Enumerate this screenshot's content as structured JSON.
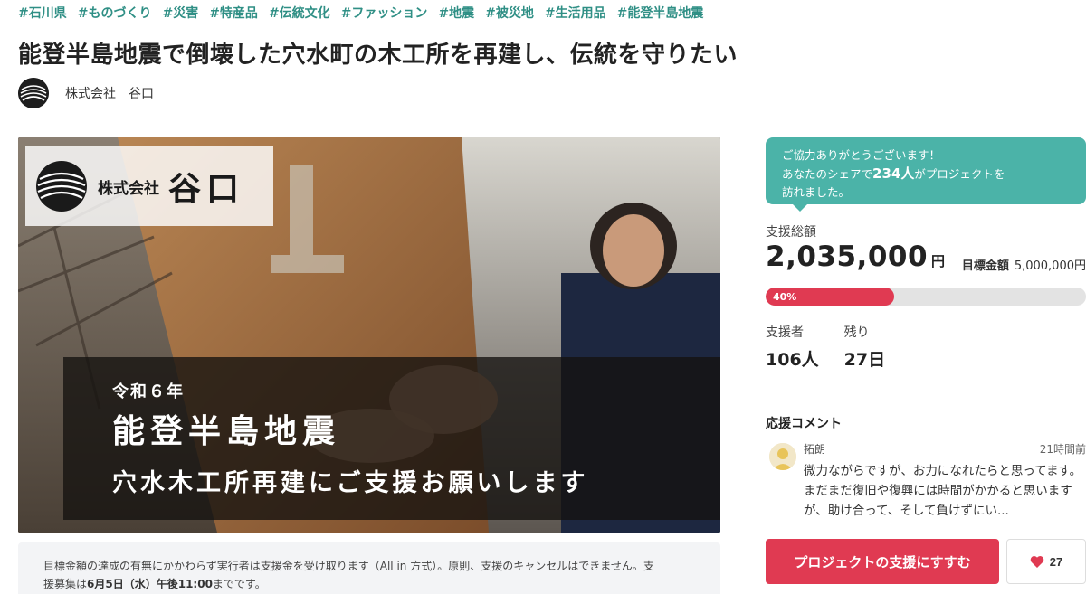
{
  "tags": [
    "#石川県",
    "#ものづくり",
    "#災害",
    "#特産品",
    "#伝統文化",
    "#ファッション",
    "#地震",
    "#被災地",
    "#生活用品",
    "#能登半島地震"
  ],
  "title": "能登半島地震で倒壊した穴水町の木工所を再建し、伝統を守りたい",
  "owner": {
    "name": "株式会社　谷口"
  },
  "hero": {
    "logo_label": "株式会社",
    "logo_name": "谷口",
    "headline_small": "令和６年",
    "headline_big": "能登半島地震",
    "headline_sub": "穴水木工所再建にご支援お願いします"
  },
  "notice": {
    "text_1": "目標金額の達成の有無にかかわらず実行者は支援金を受け取ります（All in 方式）。原則、支援のキャンセルはできません。支",
    "text_2_prefix": "援募集は",
    "text_2_bold": "6月5日（水）午後11:00",
    "text_2_suffix": "までです。"
  },
  "share": {
    "line1": "ご協力ありがとうございます！",
    "line2_prefix": "あなたのシェアで",
    "line2_bold": "234人",
    "line2_suffix": "がプロジェクトを",
    "line3": "訪れました。"
  },
  "funding": {
    "total_label": "支援総額",
    "total_amount": "2,035,000",
    "currency": "円",
    "goal_label": "目標金額",
    "goal_amount": "5,000,000円",
    "progress_percent": 40,
    "progress_label": "40%",
    "supporters_label": "支援者",
    "supporters_value": "106人",
    "remaining_label": "残り",
    "remaining_value": "27日"
  },
  "comments": {
    "heading": "応援コメント",
    "items": [
      {
        "name": "拓朗",
        "time": "21時間前",
        "text": "微力ながらですが、お力になれたらと思ってます。 まだまだ復旧や復興には時間がかかると思いますが、助け合って、そして負けずにい..."
      }
    ]
  },
  "actions": {
    "support_label": "プロジェクトの支援にすすむ",
    "like_count": "27"
  },
  "colors": {
    "accent_teal": "#2f8f85",
    "bubble_teal": "#4bb3a8",
    "primary_red": "#e03a52"
  }
}
